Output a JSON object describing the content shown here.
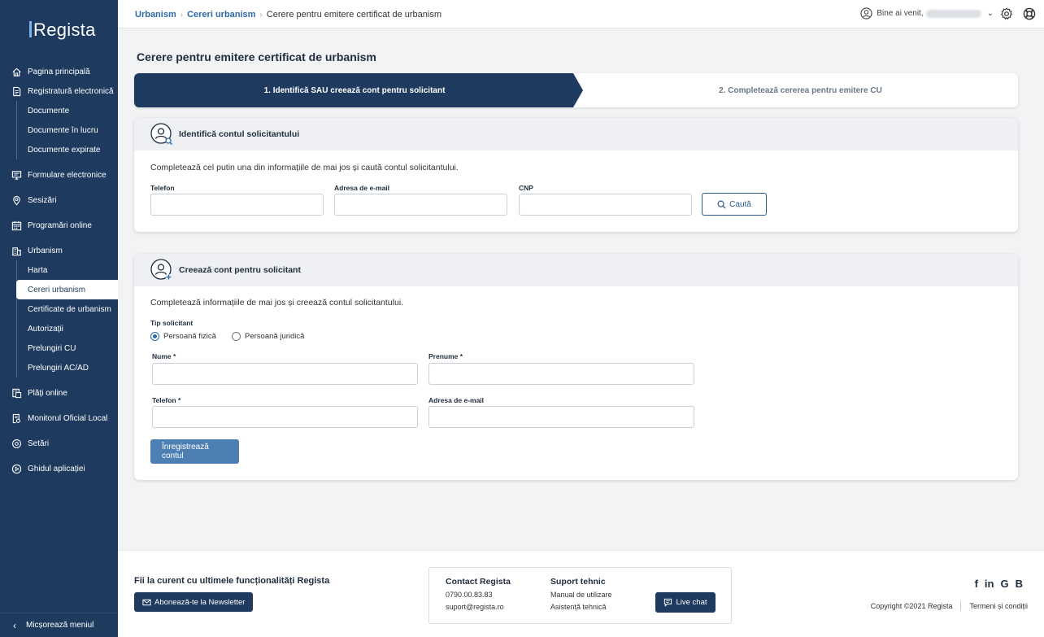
{
  "app": {
    "name": "Regista"
  },
  "sidebar": {
    "items": [
      {
        "label": "Pagina principală",
        "icon": "home-icon"
      },
      {
        "label": "Registratură electronică",
        "icon": "document-icon",
        "subs": [
          "Documente",
          "Documente în lucru",
          "Documente expirate"
        ]
      },
      {
        "label": "Formulare electronice",
        "icon": "monitor-icon"
      },
      {
        "label": "Sesizări",
        "icon": "location-pin-icon"
      },
      {
        "label": "Programări online",
        "icon": "calendar-icon"
      },
      {
        "label": "Urbanism",
        "icon": "building-icon",
        "subs": [
          "Harta",
          "Cereri urbanism",
          "Certificate de urbanism",
          "Autorizații",
          "Prelungiri CU",
          "Prelungiri AC/AD"
        ],
        "active_sub": "Cereri urbanism"
      },
      {
        "label": "Plăți online",
        "icon": "payment-icon"
      },
      {
        "label": "Monitorul Oficial Local",
        "icon": "official-document-icon"
      },
      {
        "label": "Setări",
        "icon": "settings-icon"
      },
      {
        "label": "Ghidul aplicației",
        "icon": "play-circle-icon"
      }
    ],
    "collapse_label": "Micșorează meniul"
  },
  "topbar": {
    "breadcrumb": [
      "Urbanism",
      "Cereri urbanism",
      "Cerere pentru emitere certificat de urbanism"
    ],
    "greeting": "Bine ai venit,"
  },
  "page": {
    "title": "Cerere pentru emitere certificat de urbanism",
    "steps": [
      "1. Identifică SAU creează cont pentru solicitant",
      "2. Completează cererea pentru emitere CU"
    ]
  },
  "identify": {
    "title": "Identifică contul solicitantului",
    "desc": "Completează cel putin una din informațiile de mai jos și caută contul solicitantului.",
    "phone_label": "Telefon",
    "email_label": "Adresa de e-mail",
    "cnp_label": "CNP",
    "search_label": "Caută"
  },
  "create": {
    "title": "Creează cont pentru solicitant",
    "desc": "Completează informațiile de mai jos și creează contul solicitantului.",
    "type_label": "Tip solicitant",
    "type_options": [
      "Persoană fizică",
      "Persoană juridică"
    ],
    "type_selected": "Persoană fizică",
    "last_name_label": "Nume *",
    "first_name_label": "Prenume *",
    "phone_label": "Telefon *",
    "email_label": "Adresa de e-mail",
    "submit_label": "Înregistrează contul"
  },
  "footer": {
    "newsletter_title": "Fii la curent cu ultimele funcționalități Regista",
    "newsletter_button": "Abonează-te la Newsletter",
    "contact_title": "Contact Regista",
    "contact_phone": "0790.00.83.83",
    "contact_email": "suport@regista.ro",
    "support_title": "Suport tehnic",
    "support_manual": "Manual de utilizare",
    "support_help": "Asistență tehnică",
    "live_chat": "Live chat",
    "social": [
      "f",
      "in",
      "G",
      "B"
    ],
    "copyright": "Copyright ©2021 Regista",
    "terms": "Termeni și condiții"
  },
  "colors": {
    "sidebar": "#1e3a5f",
    "accent": "#2d6ba8",
    "primary_button": "#4d7fb3"
  }
}
